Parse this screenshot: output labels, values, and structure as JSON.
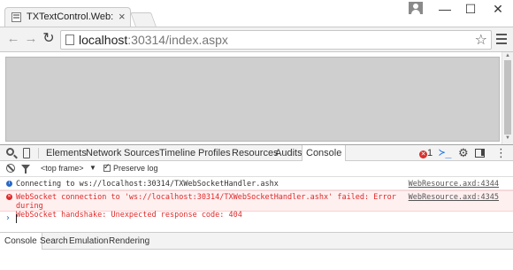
{
  "browser": {
    "tab_title": "TXTextControl.Web: Uploa",
    "tab_close": "×",
    "window_minimize": "—",
    "window_maximize": "☐",
    "window_close": "✕",
    "back": "←",
    "forward": "→",
    "reload": "↻",
    "url_host": "localhost",
    "url_port": ":30314",
    "url_path": "/index.aspx",
    "star": "☆"
  },
  "devtools": {
    "tabs": [
      "Elements",
      "Network",
      "Sources",
      "Timeline",
      "Profiles",
      "Resources",
      "Audits",
      "Console"
    ],
    "active_tab": "Console",
    "error_count": "1",
    "drawer_glyph": "≻_",
    "settings_glyph": "⚙",
    "close_glyph": "⋮",
    "frame_select": "<top frame>",
    "frame_caret": "▼",
    "preserve_log_label": "Preserve log",
    "preserve_log_checked": true,
    "messages": [
      {
        "level": "info",
        "text": "Connecting to ws://localhost:30314/TXWebSocketHandler.ashx",
        "source": "WebResource.axd:4344"
      },
      {
        "level": "error",
        "text": "WebSocket connection to 'ws://localhost:30314/TXWebSocketHandler.ashx' failed: Error during\nWebSocket handshake: Unexpected response code: 404",
        "source": "WebResource.axd:4345"
      }
    ],
    "prompt_glyph": "›",
    "drawer_tabs": [
      "Console",
      "Search",
      "Emulation",
      "Rendering"
    ],
    "drawer_active": "Console"
  },
  "colors": {
    "error": "#e02828",
    "error_bg": "#fff0f0",
    "info": "#2a67c7"
  }
}
